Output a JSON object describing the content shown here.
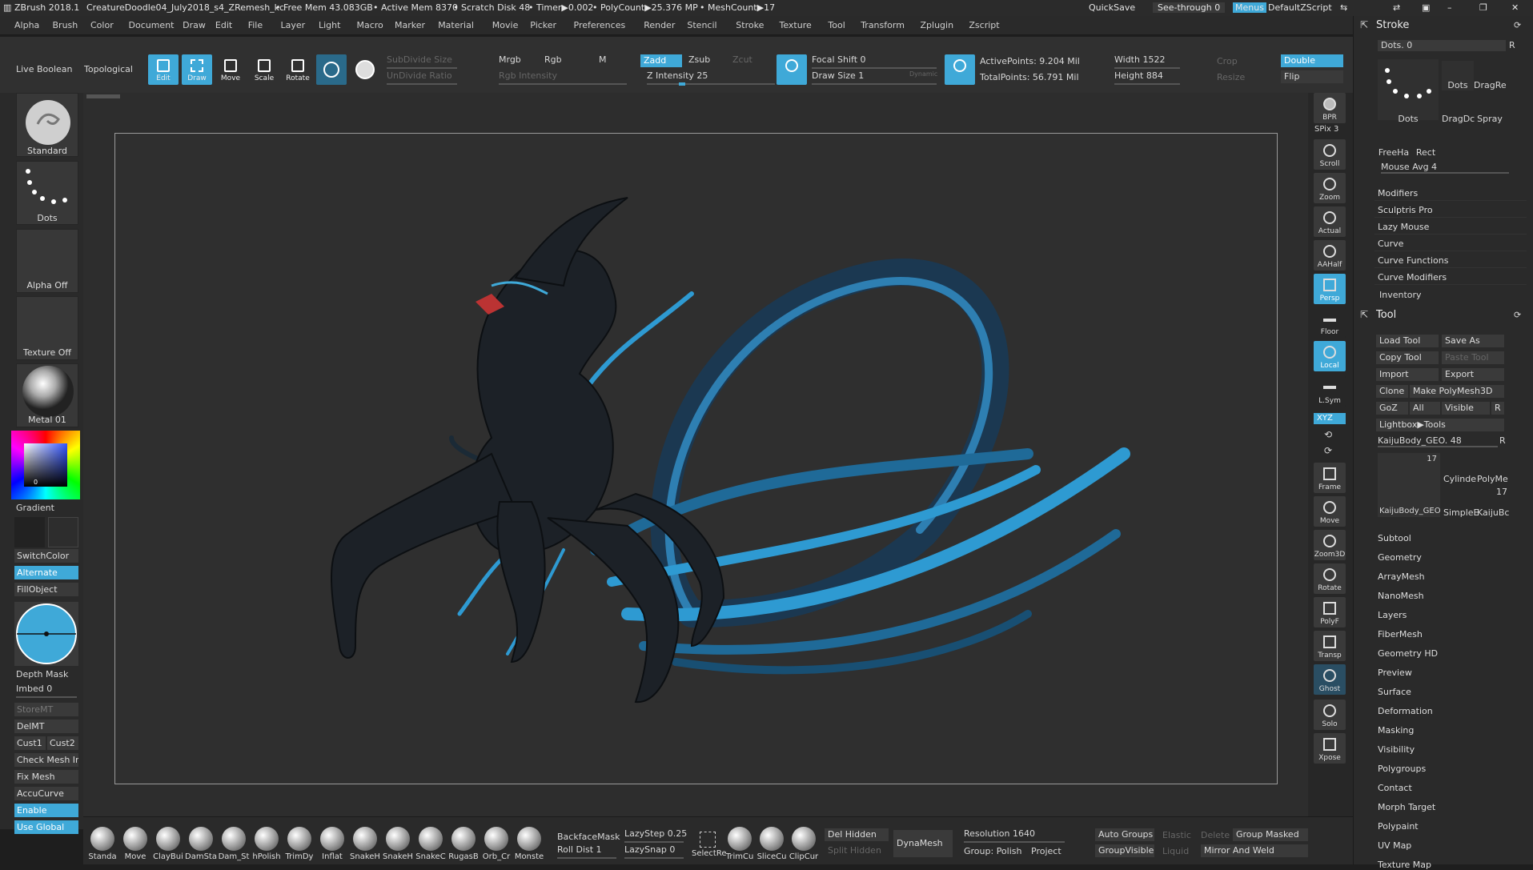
{
  "titlebar": {
    "app": "ZBrush 2018.1",
    "doc": "CreatureDoodle04_July2018_s4_ZRemesh_kc",
    "freemem": "• Free Mem 43.083GB",
    "activemem": "• Active Mem 8370",
    "scratch": "• Scratch Disk 48",
    "timer": "• Timer▶0.002",
    "polycount": "• PolyCount▶25.376 MP",
    "meshcount": "• MeshCount▶17",
    "quicksave": "QuickSave",
    "seethrough": "See-through  0",
    "menus": "Menus",
    "script": "DefaultZScript"
  },
  "menu": [
    "Alpha",
    "Brush",
    "Color",
    "Document",
    "Draw",
    "Edit",
    "File",
    "Layer",
    "Light",
    "Macro",
    "Marker",
    "Material",
    "Movie",
    "Picker",
    "Preferences",
    "Render",
    "Stencil",
    "Stroke",
    "Texture",
    "Tool",
    "Transform",
    "Zplugin",
    "Zscript"
  ],
  "toolbar": {
    "live_boolean": "Live Boolean",
    "topological": "Topological",
    "edit": "Edit",
    "draw": "Draw",
    "move": "Move",
    "scale": "Scale",
    "rotate": "Rotate",
    "subdivide_size": "SubDivide Size",
    "undivide_ratio": "UnDivide Ratio",
    "mrgb": "Mrgb",
    "rgb": "Rgb",
    "m": "M",
    "rgb_intensity": "Rgb Intensity",
    "zadd": "Zadd",
    "zsub": "Zsub",
    "zcut": "Zcut",
    "z_intensity": "Z Intensity 25",
    "focal_shift": "Focal Shift 0",
    "draw_size": "Draw Size 1",
    "dynamic": "Dynamic",
    "active_points": "ActivePoints: 9.204 Mil",
    "total_points": "TotalPoints: 56.791 Mil",
    "width": "Width 1522",
    "height": "Height 884",
    "crop": "Crop",
    "resize": "Resize",
    "double": "Double",
    "flip": "Flip",
    "z_intensity_level": 0.25
  },
  "left": {
    "standard": "Standard",
    "dots": "Dots",
    "alpha_off": "Alpha Off",
    "texture_off": "Texture Off",
    "metal": "Metal 01",
    "gradient": "Gradient",
    "switchcolor": "SwitchColor",
    "alternate": "Alternate",
    "fillobject": "FillObject",
    "depth_mask": "Depth Mask",
    "imbed": "Imbed 0",
    "storemt": "StoreMT",
    "delmt": "DelMT",
    "cust1": "Cust1",
    "cust2": "Cust2",
    "check_mesh": "Check Mesh In",
    "fix_mesh": "Fix Mesh",
    "accucurve": "AccuCurve",
    "enable": "Enable",
    "use_global": "Use Global",
    "picker_value": "0"
  },
  "shelf": {
    "bpr": "BPR",
    "spix": "SPix 3",
    "scroll": "Scroll",
    "zoom": "Zoom",
    "actual": "Actual",
    "aahalf": "AAHalf",
    "persp": "Persp",
    "floor": "Floor",
    "local": "Local",
    "lsym": "L.Sym",
    "xyz": "XYZ",
    "frame": "Frame",
    "move": "Move",
    "zoom3d": "Zoom3D",
    "rotate": "Rotate",
    "polyf": "PolyF",
    "transp": "Transp",
    "ghost": "Ghost",
    "solo": "Solo",
    "xpose": "Xpose"
  },
  "bottom": {
    "brushes": [
      "Standa",
      "Move",
      "ClayBui",
      "DamSta",
      "Dam_St",
      "hPolish",
      "TrimDy",
      "Inflat",
      "SnakeH",
      "SnakeH",
      "SnakeC",
      "RugasB",
      "Orb_Cr",
      "Monste"
    ],
    "backfacemask": "BackfaceMask",
    "lazystep": "LazyStep 0.25",
    "rolldist": "Roll Dist 1",
    "lazysnap": "LazySnap 0",
    "selectrect": "SelectRe",
    "trimcurve": "TrimCu",
    "slicecurve": "SliceCu",
    "clipcurve": "ClipCur",
    "delhidden": "Del Hidden",
    "splithidden": "Split Hidden",
    "dynamesh": "DynaMesh",
    "resolution": "Resolution 1640",
    "group": "Group: Polish",
    "project": "Project",
    "autogroups": "Auto Groups",
    "groupvisible": "GroupVisible",
    "elastic": "Elastic",
    "liquid": "Liquid",
    "delete": "Delete",
    "groupmasked": "Group Masked",
    "mirrorweld": "Mirror And Weld"
  },
  "right": {
    "stroke": "Stroke",
    "dots": "Dots. 0",
    "r": "R",
    "dots_lbl": "Dots",
    "dragrect": "DragRe",
    "dragdot": "DragDc",
    "spray": "Spray",
    "freehand": "FreeHa",
    "rect": "Rect",
    "mouse_avg": "Mouse Avg 4",
    "stroke_items": [
      "Modifiers",
      "Sculptris Pro",
      "Lazy Mouse",
      "Curve",
      "Curve Functions",
      "Curve Modifiers"
    ],
    "inventory": "Inventory",
    "tool": "Tool",
    "load_tool": "Load Tool",
    "save_as": "Save As",
    "copy_tool": "Copy Tool",
    "paste_tool": "Paste Tool",
    "import": "Import",
    "export": "Export",
    "clone": "Clone",
    "make_polymesh": "Make PolyMesh3D",
    "goz": "GoZ",
    "all": "All",
    "visible": "Visible",
    "lightbox": "Lightbox▶Tools",
    "kaiju": "KaijuBody_GEO. 48",
    "count17": "17",
    "cylinder": "Cylinde",
    "polyme": "PolyMe",
    "kaiju_geo": "KaijuBody_GEO",
    "simple": "SimpleE",
    "kaijubc": "KaijuBc",
    "tool_items": [
      "Subtool",
      "Geometry",
      "ArrayMesh",
      "NanoMesh",
      "Layers",
      "FiberMesh",
      "Geometry HD",
      "Preview",
      "Surface",
      "Deformation",
      "Masking",
      "Visibility",
      "Polygroups",
      "Contact",
      "Morph Target",
      "Polypaint",
      "UV Map",
      "Texture Map"
    ]
  },
  "colors": {
    "accent": "#3fa9d8",
    "creature_glow": "#2f9fd6"
  }
}
